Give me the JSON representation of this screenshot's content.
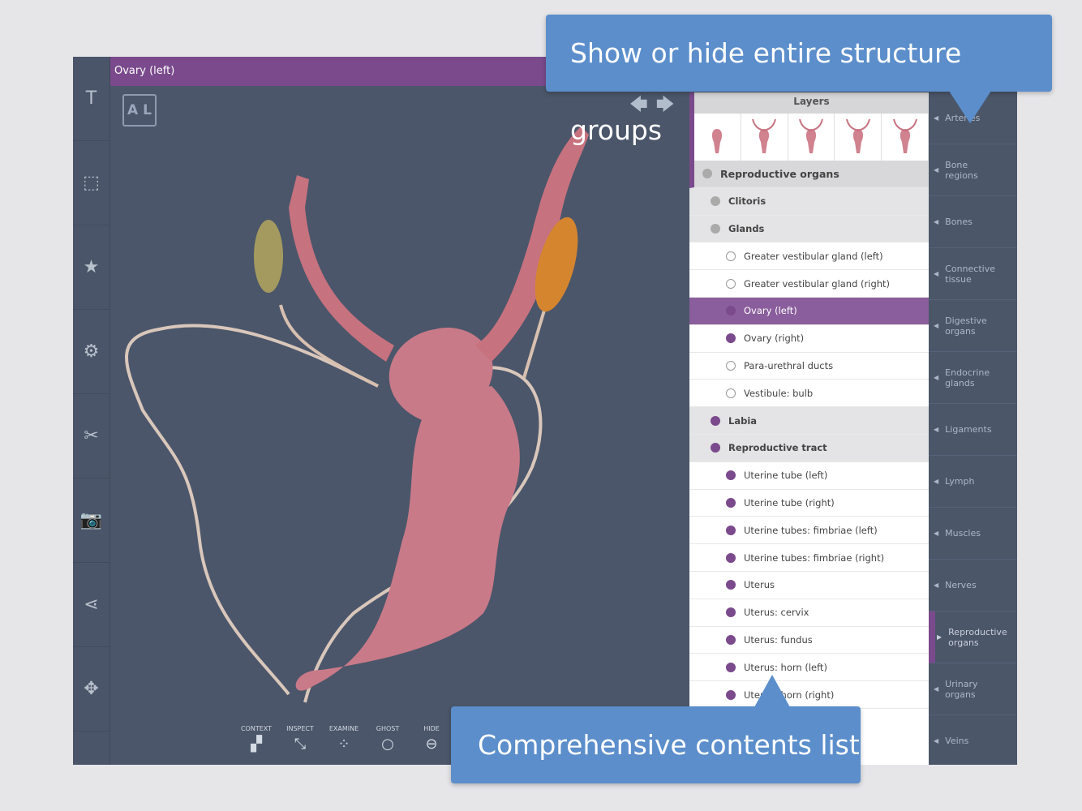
{
  "titlebar": {
    "title": "Ovary (left)"
  },
  "view": {
    "cube_label": "A L",
    "back": "🡄",
    "fwd": "🡆"
  },
  "tools": [
    {
      "label": "CONTEXT",
      "icon": "▞"
    },
    {
      "label": "INSPECT",
      "icon": "⤡"
    },
    {
      "label": "EXAMINE",
      "icon": "⁘"
    },
    {
      "label": "GHOST",
      "icon": "○"
    },
    {
      "label": "HIDE",
      "icon": "⊖"
    }
  ],
  "sidebar": [
    {
      "name": "text-icon",
      "g": "T"
    },
    {
      "name": "select-box-icon",
      "g": "⬚"
    },
    {
      "name": "star-icon",
      "g": "★"
    },
    {
      "name": "gear-icon",
      "g": "⚙"
    },
    {
      "name": "tools-icon",
      "g": "✂"
    },
    {
      "name": "camera-icon",
      "g": "📷"
    },
    {
      "name": "share-icon",
      "g": "⋖"
    },
    {
      "name": "move-icon",
      "g": "✥"
    }
  ],
  "panel": {
    "header": "Layers",
    "rows": [
      {
        "label": "Reproductive organs",
        "kind": "top",
        "dot": "grey"
      },
      {
        "label": "Clitoris",
        "kind": "grp",
        "dot": "grey"
      },
      {
        "label": "Glands",
        "kind": "grp",
        "dot": "grey"
      },
      {
        "label": "Greater vestibular gland (left)",
        "kind": "item",
        "dot": "empty"
      },
      {
        "label": "Greater vestibular gland (right)",
        "kind": "item",
        "dot": "empty"
      },
      {
        "label": "Ovary (left)",
        "kind": "sel",
        "dot": "purple"
      },
      {
        "label": "Ovary (right)",
        "kind": "item",
        "dot": "purple"
      },
      {
        "label": "Para-urethral ducts",
        "kind": "item",
        "dot": "empty"
      },
      {
        "label": "Vestibule: bulb",
        "kind": "item",
        "dot": "empty"
      },
      {
        "label": "Labia",
        "kind": "grp",
        "dot": "purple"
      },
      {
        "label": "Reproductive tract",
        "kind": "grp",
        "dot": "purple"
      },
      {
        "label": "Uterine tube (left)",
        "kind": "item",
        "dot": "purple"
      },
      {
        "label": "Uterine tube (right)",
        "kind": "item",
        "dot": "purple"
      },
      {
        "label": "Uterine tubes: fimbriae (left)",
        "kind": "item",
        "dot": "purple"
      },
      {
        "label": "Uterine tubes: fimbriae (right)",
        "kind": "item",
        "dot": "purple"
      },
      {
        "label": "Uterus",
        "kind": "item",
        "dot": "purple"
      },
      {
        "label": "Uterus: cervix",
        "kind": "item",
        "dot": "purple"
      },
      {
        "label": "Uterus: fundus",
        "kind": "item",
        "dot": "purple"
      },
      {
        "label": "Uterus: horn (left)",
        "kind": "item",
        "dot": "purple"
      },
      {
        "label": "Uterus: horn (right)",
        "kind": "item",
        "dot": "purple"
      }
    ]
  },
  "rail": [
    "Arteries",
    "Bone regions",
    "Bones",
    "Connective tissue",
    "Digestive organs",
    "Endocrine glands",
    "Ligaments",
    "Lymph",
    "Muscles",
    "Nerves",
    "Reproductive organs",
    "Urinary organs",
    "Veins"
  ],
  "rail_active": "Reproductive organs",
  "callouts": {
    "top": "Show or hide entire structure groups",
    "bottom": "Comprehensive contents list"
  }
}
